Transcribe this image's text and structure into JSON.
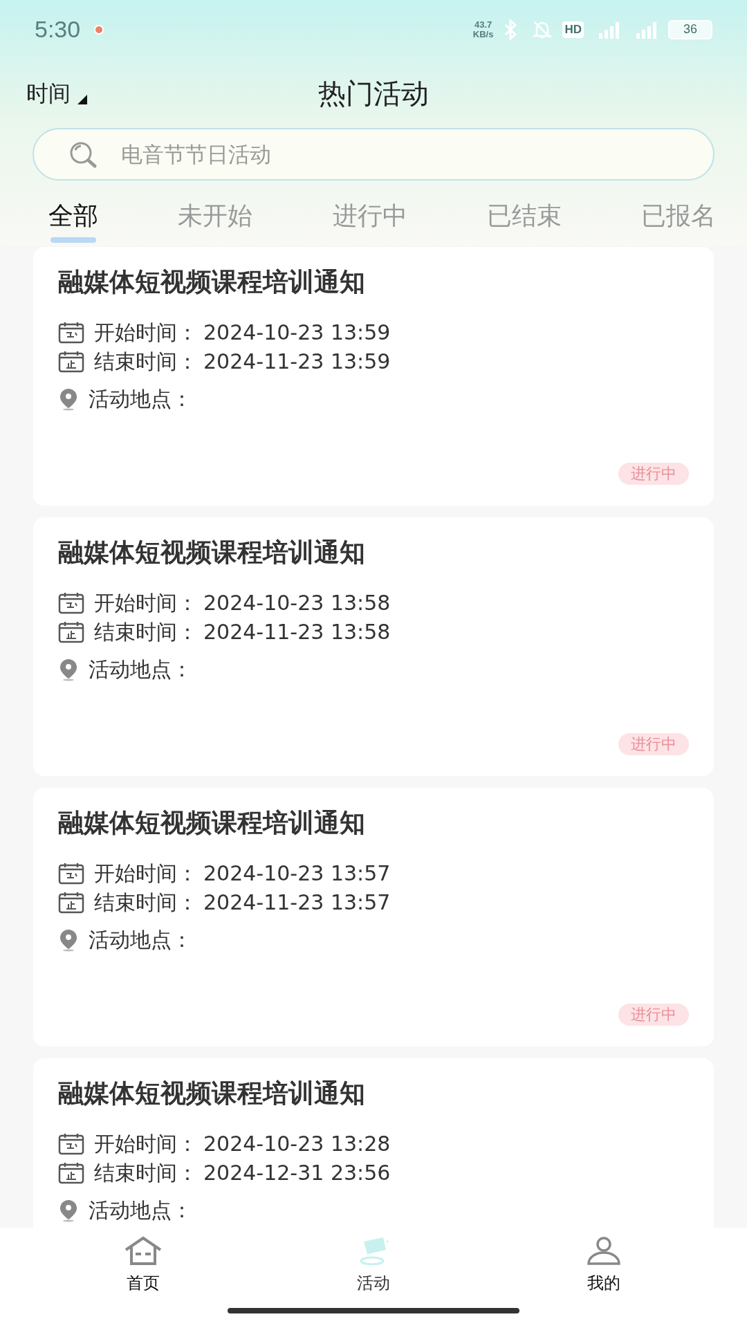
{
  "status_bar": {
    "time": "5:30",
    "net_speed": "43.7\nKB/s",
    "battery": "36",
    "hd_badge": "HD"
  },
  "header": {
    "filter": "时间",
    "title": "热门活动"
  },
  "search": {
    "placeholder": "电音节节日活动"
  },
  "tabs": [
    {
      "label": "全部",
      "selected": true
    },
    {
      "label": "未开始",
      "selected": false
    },
    {
      "label": "进行中",
      "selected": false
    },
    {
      "label": "已结束",
      "selected": false
    },
    {
      "label": "已报名",
      "selected": false
    }
  ],
  "activities": [
    {
      "title": "融媒体短视频课程培训通知",
      "start_label": "开始时间：",
      "start": "2024-10-23 13:59",
      "end_label": "结束时间：",
      "end": "2024-11-23 13:59",
      "location_label": "活动地点：",
      "status": "进行中"
    },
    {
      "title": "融媒体短视频课程培训通知",
      "start_label": "开始时间：",
      "start": "2024-10-23 13:58",
      "end_label": "结束时间：",
      "end": "2024-11-23 13:58",
      "location_label": "活动地点：",
      "status": "进行中"
    },
    {
      "title": "融媒体短视频课程培训通知",
      "start_label": "开始时间：",
      "start": "2024-10-23 13:57",
      "end_label": "结束时间：",
      "end": "2024-11-23 13:57",
      "location_label": "活动地点：",
      "status": "进行中"
    },
    {
      "title": "融媒体短视频课程培训通知",
      "start_label": "开始时间：",
      "start": "2024-10-23 13:28",
      "end_label": "结束时间：",
      "end": "2024-12-31 23:56",
      "location_label": "活动地点："
    }
  ],
  "bottom_nav": [
    {
      "label": "首页",
      "kind": "home",
      "selected": false
    },
    {
      "label": "活动",
      "kind": "activity",
      "selected": true
    },
    {
      "label": "我的",
      "kind": "profile",
      "selected": false
    }
  ]
}
